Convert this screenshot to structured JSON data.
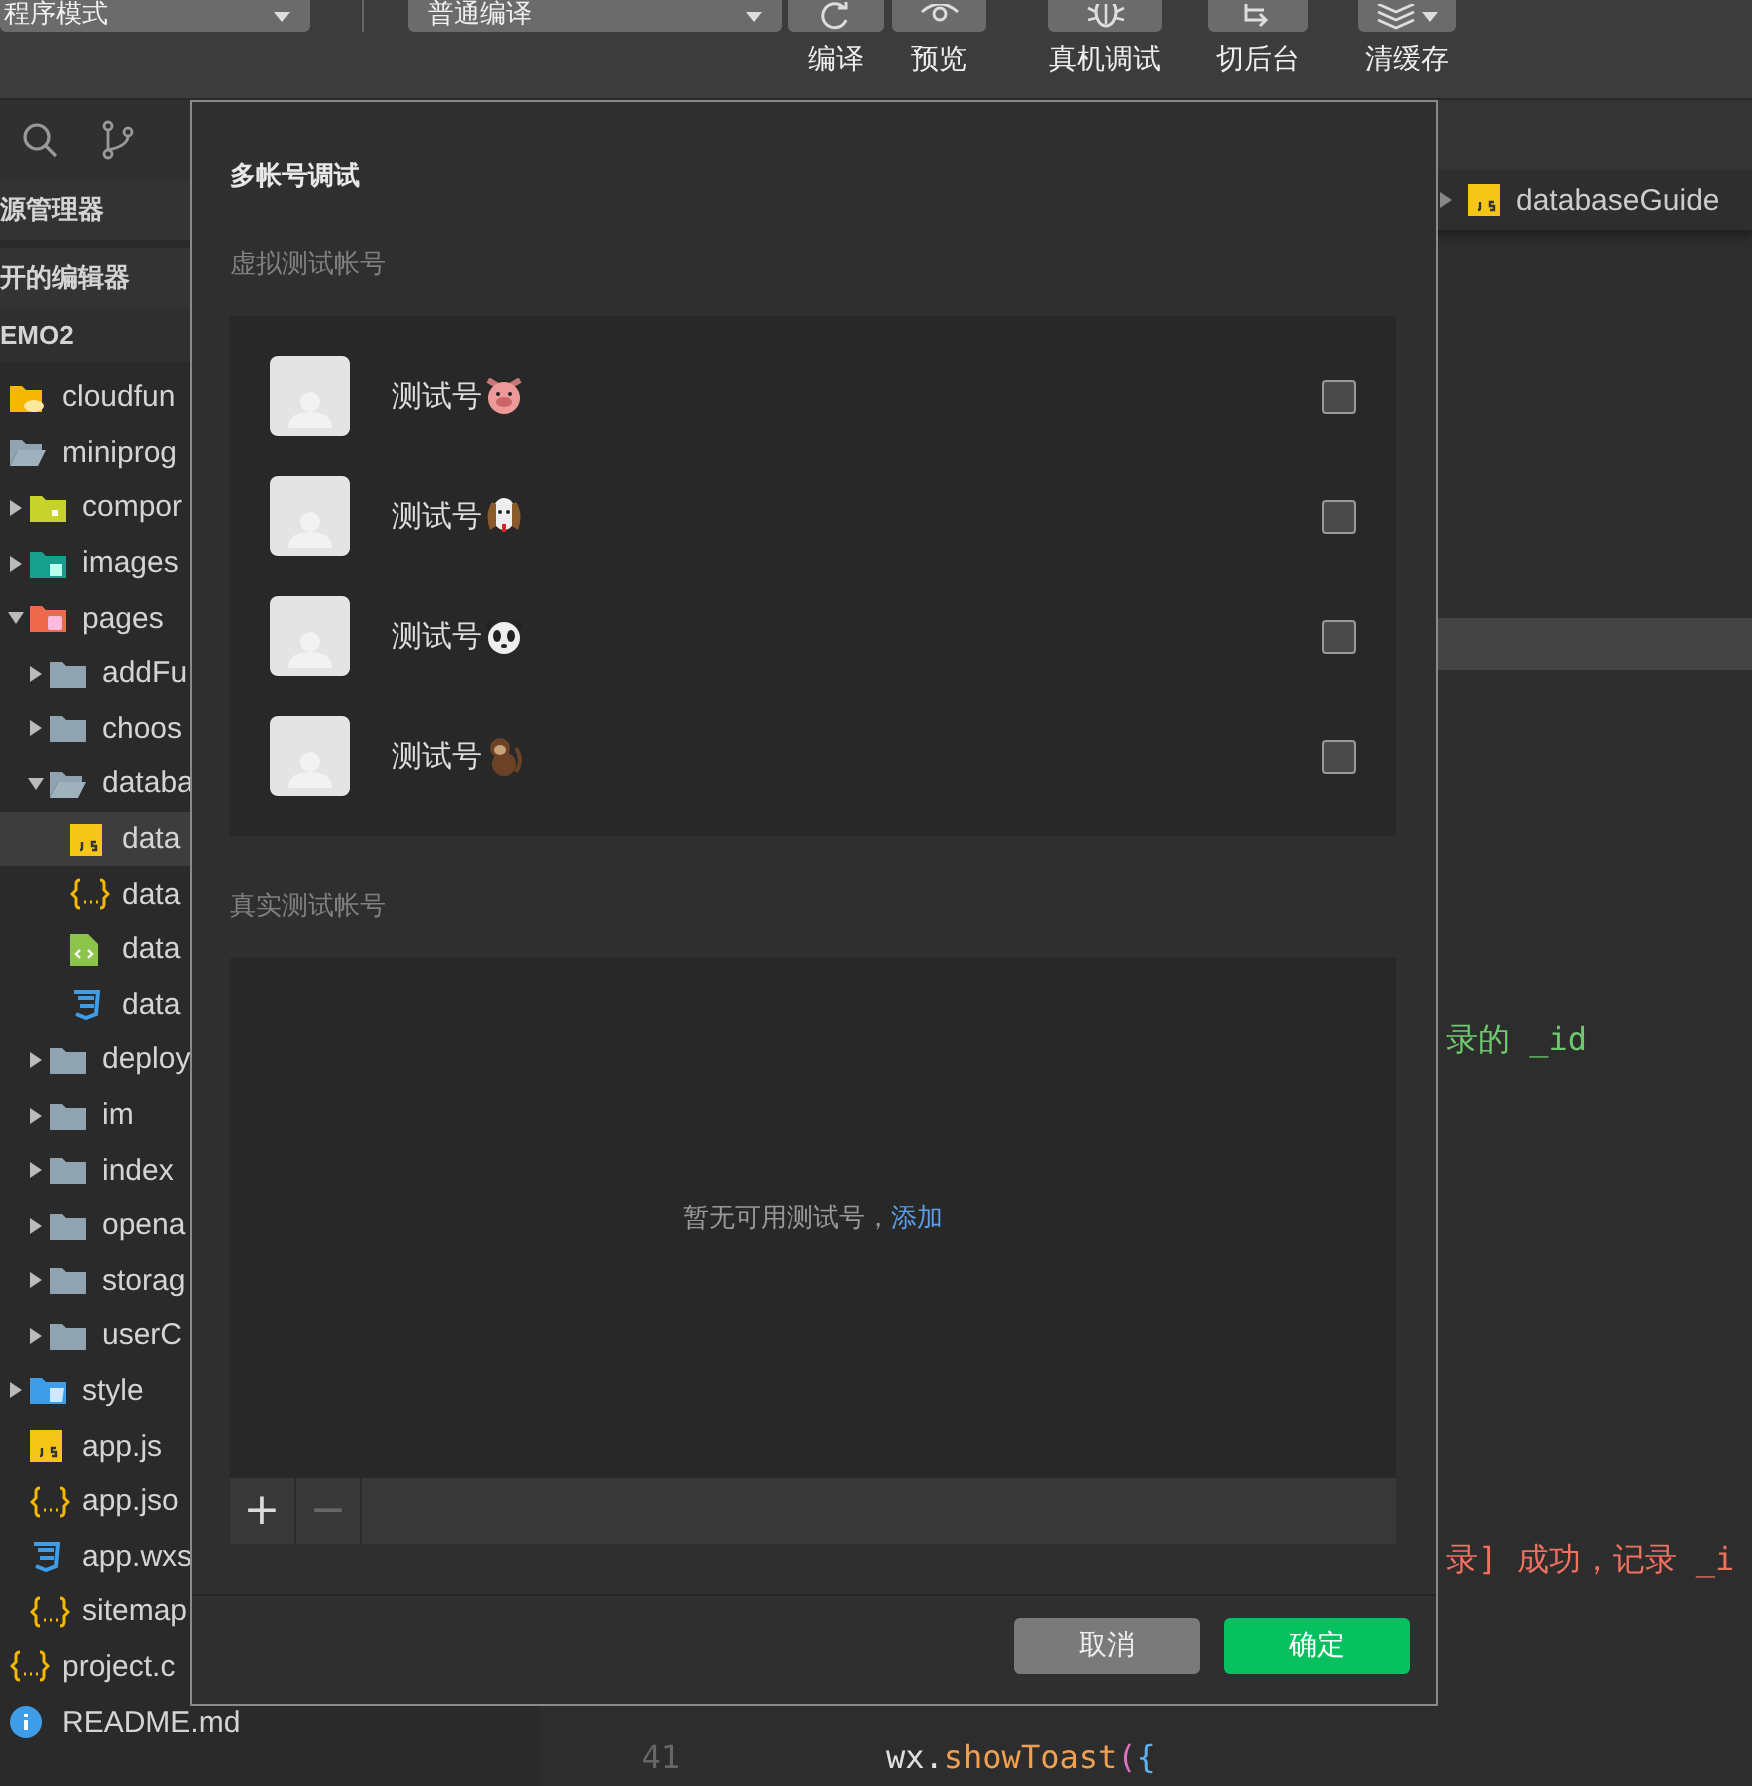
{
  "toolbar": {
    "mode_dropdown": "程序模式",
    "compile_dropdown": "普通编译",
    "tools": [
      {
        "label": "编译"
      },
      {
        "label": "预览"
      },
      {
        "label": "真机调试"
      },
      {
        "label": "切后台"
      },
      {
        "label": "清缓存"
      }
    ]
  },
  "sidebar": {
    "section_title": "源管理器",
    "open_editors": "开的编辑器",
    "project": "EMO2",
    "tree": [
      {
        "label": "cloudfun",
        "kind": "cloud-folder",
        "selected": false
      },
      {
        "label": "miniprog",
        "kind": "open-folder",
        "selected": false,
        "children": [
          {
            "label": "compor",
            "kind": "component-folder",
            "expanded": false,
            "selected": false
          },
          {
            "label": "images",
            "kind": "image-folder",
            "expanded": false,
            "selected": false
          },
          {
            "label": "pages",
            "kind": "pages-folder",
            "expanded": true,
            "selected": false,
            "children": [
              {
                "label": "addFu",
                "kind": "folder",
                "expanded": false,
                "selected": false
              },
              {
                "label": "choos",
                "kind": "folder",
                "expanded": false,
                "selected": false
              },
              {
                "label": "databa",
                "kind": "open-folder",
                "expanded": true,
                "selected": false,
                "children": [
                  {
                    "label": "data",
                    "kind": "js",
                    "selected": true
                  },
                  {
                    "label": "data",
                    "kind": "json",
                    "selected": false
                  },
                  {
                    "label": "data",
                    "kind": "wxml",
                    "selected": false
                  },
                  {
                    "label": "data",
                    "kind": "wxss",
                    "selected": false
                  }
                ]
              },
              {
                "label": "deploy",
                "kind": "folder",
                "expanded": false,
                "selected": false
              },
              {
                "label": "im",
                "kind": "folder",
                "expanded": false,
                "selected": false
              },
              {
                "label": "index",
                "kind": "folder",
                "expanded": false,
                "selected": false
              },
              {
                "label": "opena",
                "kind": "folder",
                "expanded": false,
                "selected": false
              },
              {
                "label": "storag",
                "kind": "folder",
                "expanded": false,
                "selected": false
              },
              {
                "label": "userC",
                "kind": "folder",
                "expanded": false,
                "selected": false
              }
            ]
          },
          {
            "label": "style",
            "kind": "style-folder",
            "expanded": false,
            "selected": false
          },
          {
            "label": "app.js",
            "kind": "js",
            "selected": false
          },
          {
            "label": "app.jso",
            "kind": "json",
            "selected": false
          },
          {
            "label": "app.wxs",
            "kind": "wxss",
            "selected": false
          },
          {
            "label": "sitemap",
            "kind": "json",
            "selected": false
          }
        ]
      },
      {
        "label": "project.c",
        "kind": "json",
        "selected": false
      },
      {
        "label": "README.md",
        "kind": "info",
        "selected": false
      }
    ]
  },
  "editor": {
    "breadcrumb": "databaseGuide",
    "lines": [
      {
        "tokens": [
          {
            "text": "录的 _id",
            "kind": "comment"
          }
        ]
      },
      {
        "tokens": [
          {
            "text": "录] 成功，记录 _i",
            "kind": "string"
          }
        ]
      },
      {
        "number": "41",
        "tokens": [
          {
            "text": "wx",
            "kind": "plain"
          },
          {
            "text": ".",
            "kind": "plain"
          },
          {
            "text": "showToast",
            "kind": "fn"
          },
          {
            "text": "(",
            "kind": "paren"
          },
          {
            "text": "{",
            "kind": "brace"
          }
        ]
      }
    ]
  },
  "dialog": {
    "title": "多帐号调试",
    "virtual_label": "虚拟测试帐号",
    "virtual_accounts": [
      {
        "name": "测试号",
        "checked": false
      },
      {
        "name": "测试号",
        "checked": false
      },
      {
        "name": "测试号",
        "checked": false
      },
      {
        "name": "测试号",
        "checked": false
      }
    ],
    "real_label": "真实测试帐号",
    "empty_text": "暂无可用测试号，",
    "add_link": "添加",
    "add_button": "+",
    "remove_button": "−",
    "buttons": [
      {
        "label": "取消",
        "kind": "secondary"
      },
      {
        "label": "确定",
        "kind": "primary"
      }
    ]
  }
}
